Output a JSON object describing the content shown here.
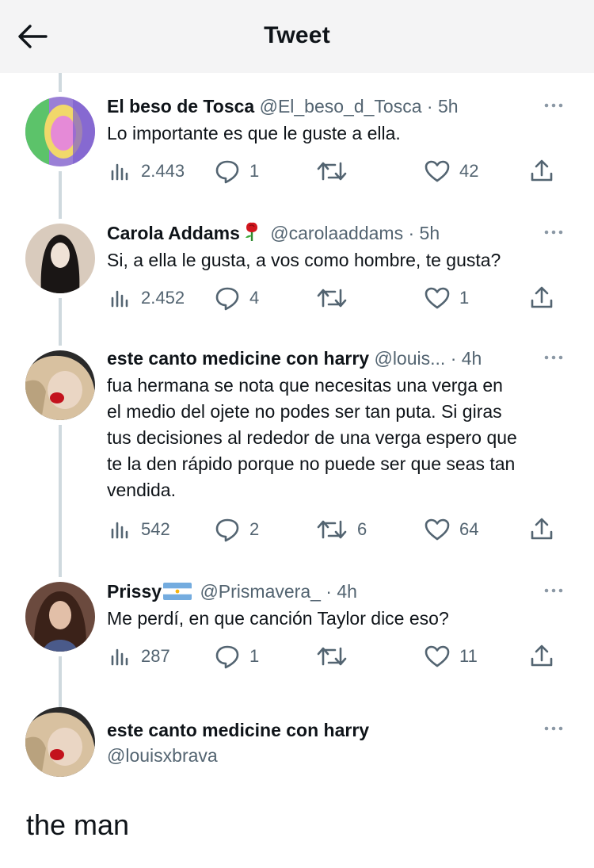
{
  "header": {
    "title": "Tweet"
  },
  "tweets": [
    {
      "name": "El beso de Tosca",
      "handle": "@El_beso_d_Tosca",
      "dot": "·",
      "time": "5h",
      "text": "Lo importante es que le guste a ella.",
      "views": "2.443",
      "replies": "1",
      "retweets": "",
      "likes": "42"
    },
    {
      "name": "Carola Addams",
      "name_emoji": "rose-emoji",
      "handle": "@carolaaddams",
      "dot": "·",
      "time": "5h",
      "text": "Si, a ella le gusta, a vos como hombre, te gusta?",
      "views": "2.452",
      "replies": "4",
      "retweets": "",
      "likes": "1"
    },
    {
      "name": "este canto medicine con harry",
      "handle": "@louis...",
      "dot": "·",
      "time": "4h",
      "text_lines": [
        "fua hermana se nota que necesitas una verga en",
        "el medio del ojete no podes ser tan puta. Si giras",
        "tus decisiones al rededor de una verga espero que",
        "te la den rápido porque no puede ser que seas tan",
        "vendida."
      ],
      "views": "542",
      "replies": "2",
      "retweets": "6",
      "likes": "64"
    },
    {
      "name": "Prissy",
      "name_emoji": "argentina-flag-emoji",
      "handle": "@Prismavera_",
      "dot": "·",
      "time": "4h",
      "text": "Me perdí, en que canción Taylor dice eso?",
      "views": "287",
      "replies": "1",
      "retweets": "",
      "likes": "11"
    }
  ],
  "main_tweet": {
    "name": "este canto medicine con harry",
    "handle": "@louisxbrava"
  },
  "caption": "the man",
  "colors": {
    "text": "#0f1419",
    "secondary": "#536471",
    "thread_line": "#cfd9de",
    "header_bg": "#f4f4f5"
  }
}
